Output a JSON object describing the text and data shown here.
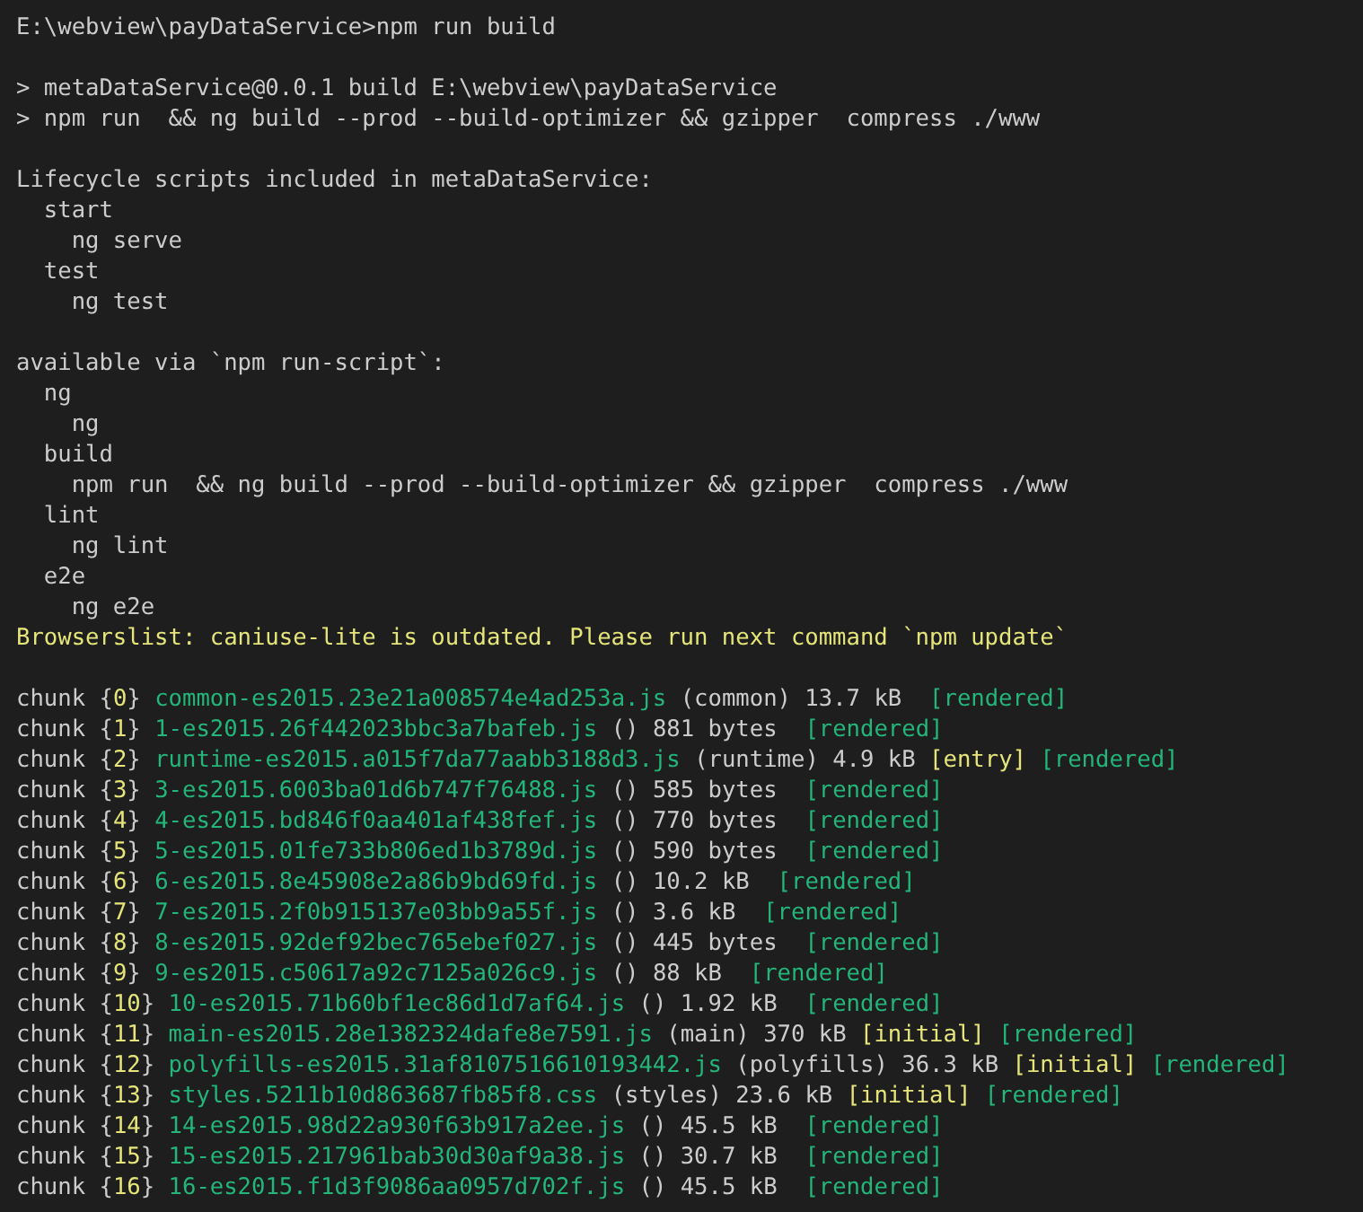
{
  "terminal": {
    "lines": [
      {
        "kind": "text",
        "text": "E:\\webview\\payDataService>npm run build"
      },
      {
        "kind": "blank"
      },
      {
        "kind": "text",
        "text": "> metaDataService@0.0.1 build E:\\webview\\payDataService"
      },
      {
        "kind": "text",
        "text": "> npm run  && ng build --prod --build-optimizer && gzipper  compress ./www"
      },
      {
        "kind": "blank"
      },
      {
        "kind": "text",
        "text": "Lifecycle scripts included in metaDataService:"
      },
      {
        "kind": "text",
        "text": "  start"
      },
      {
        "kind": "text",
        "text": "    ng serve"
      },
      {
        "kind": "text",
        "text": "  test"
      },
      {
        "kind": "text",
        "text": "    ng test"
      },
      {
        "kind": "blank"
      },
      {
        "kind": "text",
        "text": "available via `npm run-script`:"
      },
      {
        "kind": "text",
        "text": "  ng"
      },
      {
        "kind": "text",
        "text": "    ng"
      },
      {
        "kind": "text",
        "text": "  build"
      },
      {
        "kind": "text",
        "text": "    npm run  && ng build --prod --build-optimizer && gzipper  compress ./www"
      },
      {
        "kind": "text",
        "text": "  lint"
      },
      {
        "kind": "text",
        "text": "    ng lint"
      },
      {
        "kind": "text",
        "text": "  e2e"
      },
      {
        "kind": "text",
        "text": "    ng e2e"
      },
      {
        "kind": "warning",
        "text": "Browserslist: caniuse-lite is outdated. Please run next command `npm update`"
      },
      {
        "kind": "blank"
      },
      {
        "kind": "chunk",
        "prefix": "chunk {",
        "id": "0",
        "suffix": "}",
        "file": "common-es2015.23e21a008574e4ad253a.js",
        "details": "(common) 13.7 kB",
        "flags": [
          {
            "text": "[rendered]",
            "kind": "rendered"
          }
        ]
      },
      {
        "kind": "chunk",
        "prefix": "chunk {",
        "id": "1",
        "suffix": "}",
        "file": "1-es2015.26f442023bbc3a7bafeb.js",
        "details": "() 881 bytes",
        "flags": [
          {
            "text": "[rendered]",
            "kind": "rendered"
          }
        ]
      },
      {
        "kind": "chunk",
        "prefix": "chunk {",
        "id": "2",
        "suffix": "}",
        "file": "runtime-es2015.a015f7da77aabb3188d3.js",
        "details": "(runtime) 4.9 kB",
        "flags": [
          {
            "text": "[entry]",
            "kind": "entry"
          },
          {
            "text": "[rendered]",
            "kind": "rendered"
          }
        ]
      },
      {
        "kind": "chunk",
        "prefix": "chunk {",
        "id": "3",
        "suffix": "}",
        "file": "3-es2015.6003ba01d6b747f76488.js",
        "details": "() 585 bytes",
        "flags": [
          {
            "text": "[rendered]",
            "kind": "rendered"
          }
        ]
      },
      {
        "kind": "chunk",
        "prefix": "chunk {",
        "id": "4",
        "suffix": "}",
        "file": "4-es2015.bd846f0aa401af438fef.js",
        "details": "() 770 bytes",
        "flags": [
          {
            "text": "[rendered]",
            "kind": "rendered"
          }
        ]
      },
      {
        "kind": "chunk",
        "prefix": "chunk {",
        "id": "5",
        "suffix": "}",
        "file": "5-es2015.01fe733b806ed1b3789d.js",
        "details": "() 590 bytes",
        "flags": [
          {
            "text": "[rendered]",
            "kind": "rendered"
          }
        ]
      },
      {
        "kind": "chunk",
        "prefix": "chunk {",
        "id": "6",
        "suffix": "}",
        "file": "6-es2015.8e45908e2a86b9bd69fd.js",
        "details": "() 10.2 kB",
        "flags": [
          {
            "text": "[rendered]",
            "kind": "rendered"
          }
        ]
      },
      {
        "kind": "chunk",
        "prefix": "chunk {",
        "id": "7",
        "suffix": "}",
        "file": "7-es2015.2f0b915137e03bb9a55f.js",
        "details": "() 3.6 kB",
        "flags": [
          {
            "text": "[rendered]",
            "kind": "rendered"
          }
        ]
      },
      {
        "kind": "chunk",
        "prefix": "chunk {",
        "id": "8",
        "suffix": "}",
        "file": "8-es2015.92def92bec765ebef027.js",
        "details": "() 445 bytes",
        "flags": [
          {
            "text": "[rendered]",
            "kind": "rendered"
          }
        ]
      },
      {
        "kind": "chunk",
        "prefix": "chunk {",
        "id": "9",
        "suffix": "}",
        "file": "9-es2015.c50617a92c7125a026c9.js",
        "details": "() 88 kB",
        "flags": [
          {
            "text": "[rendered]",
            "kind": "rendered"
          }
        ]
      },
      {
        "kind": "chunk",
        "prefix": "chunk {",
        "id": "10",
        "suffix": "}",
        "file": "10-es2015.71b60bf1ec86d1d7af64.js",
        "details": "() 1.92 kB",
        "flags": [
          {
            "text": "[rendered]",
            "kind": "rendered"
          }
        ]
      },
      {
        "kind": "chunk",
        "prefix": "chunk {",
        "id": "11",
        "suffix": "}",
        "file": "main-es2015.28e1382324dafe8e7591.js",
        "details": "(main) 370 kB",
        "flags": [
          {
            "text": "[initial]",
            "kind": "initial"
          },
          {
            "text": "[rendered]",
            "kind": "rendered"
          }
        ]
      },
      {
        "kind": "chunk",
        "prefix": "chunk {",
        "id": "12",
        "suffix": "}",
        "file": "polyfills-es2015.31af8107516610193442.js",
        "details": "(polyfills) 36.3 kB",
        "flags": [
          {
            "text": "[initial]",
            "kind": "initial"
          },
          {
            "text": "[rendered]",
            "kind": "rendered"
          }
        ]
      },
      {
        "kind": "chunk",
        "prefix": "chunk {",
        "id": "13",
        "suffix": "}",
        "file": "styles.5211b10d863687fb85f8.css",
        "details": "(styles) 23.6 kB",
        "flags": [
          {
            "text": "[initial]",
            "kind": "initial"
          },
          {
            "text": "[rendered]",
            "kind": "rendered"
          }
        ]
      },
      {
        "kind": "chunk",
        "prefix": "chunk {",
        "id": "14",
        "suffix": "}",
        "file": "14-es2015.98d22a930f63b917a2ee.js",
        "details": "() 45.5 kB",
        "flags": [
          {
            "text": "[rendered]",
            "kind": "rendered"
          }
        ]
      },
      {
        "kind": "chunk",
        "prefix": "chunk {",
        "id": "15",
        "suffix": "}",
        "file": "15-es2015.217961bab30d30af9a38.js",
        "details": "() 30.7 kB",
        "flags": [
          {
            "text": "[rendered]",
            "kind": "rendered"
          }
        ]
      },
      {
        "kind": "chunk",
        "prefix": "chunk {",
        "id": "16",
        "suffix": "}",
        "file": "16-es2015.f1d3f9086aa0957d702f.js",
        "details": "() 45.5 kB",
        "flags": [
          {
            "text": "[rendered]",
            "kind": "rendered"
          }
        ]
      }
    ]
  }
}
